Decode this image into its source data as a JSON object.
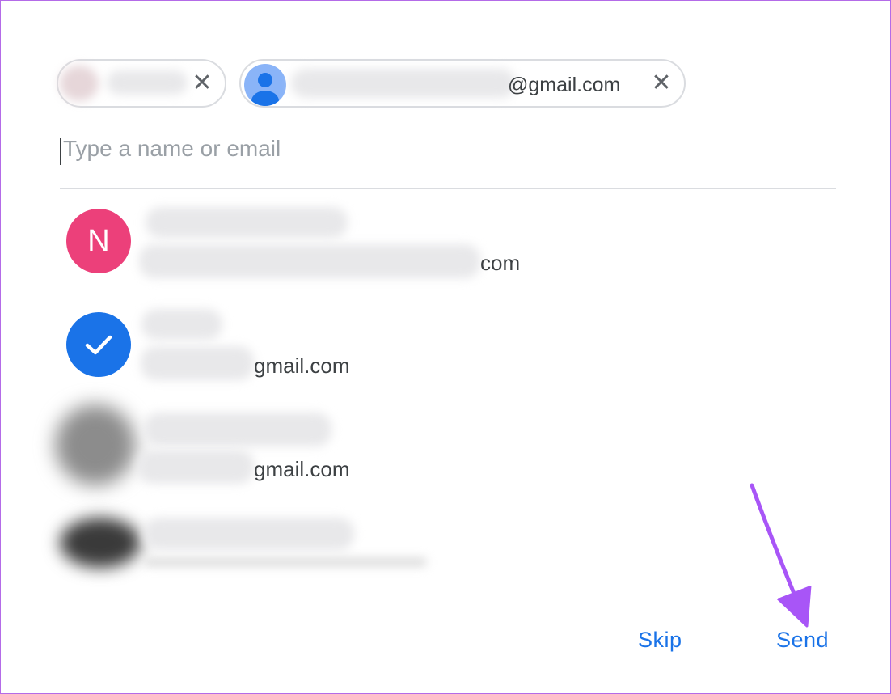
{
  "recipients": [
    {
      "name_visible": "",
      "email_suffix": ""
    },
    {
      "email_suffix": "@gmail.com"
    }
  ],
  "remove_glyph": "✕",
  "search": {
    "placeholder": "Type a name or email"
  },
  "contacts": [
    {
      "avatar_letter": "N",
      "avatar_color": "#ec407a",
      "email_suffix": "com",
      "selected": false
    },
    {
      "avatar_color": "#1a73e8",
      "email_suffix": "gmail.com",
      "selected": true
    },
    {
      "email_suffix": "gmail.com",
      "selected": false
    },
    {
      "email_suffix": "",
      "selected": false
    }
  ],
  "actions": {
    "skip": "Skip",
    "send": "Send"
  },
  "colors": {
    "accent": "#1a73e8",
    "annotation_arrow": "#a855f7"
  }
}
